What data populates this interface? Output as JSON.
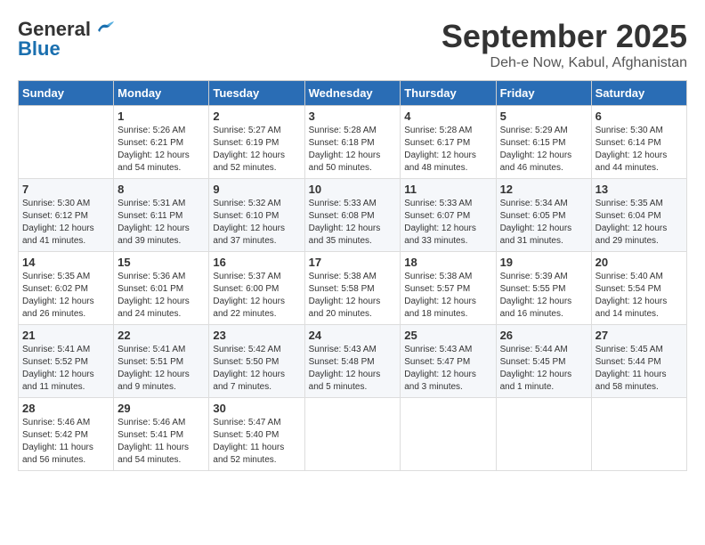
{
  "header": {
    "logo_line1": "General",
    "logo_line2": "Blue",
    "title": "September 2025",
    "subtitle": "Deh-e Now, Kabul, Afghanistan"
  },
  "weekdays": [
    "Sunday",
    "Monday",
    "Tuesday",
    "Wednesday",
    "Thursday",
    "Friday",
    "Saturday"
  ],
  "weeks": [
    [
      {
        "day": "",
        "info": ""
      },
      {
        "day": "1",
        "info": "Sunrise: 5:26 AM\nSunset: 6:21 PM\nDaylight: 12 hours\nand 54 minutes."
      },
      {
        "day": "2",
        "info": "Sunrise: 5:27 AM\nSunset: 6:19 PM\nDaylight: 12 hours\nand 52 minutes."
      },
      {
        "day": "3",
        "info": "Sunrise: 5:28 AM\nSunset: 6:18 PM\nDaylight: 12 hours\nand 50 minutes."
      },
      {
        "day": "4",
        "info": "Sunrise: 5:28 AM\nSunset: 6:17 PM\nDaylight: 12 hours\nand 48 minutes."
      },
      {
        "day": "5",
        "info": "Sunrise: 5:29 AM\nSunset: 6:15 PM\nDaylight: 12 hours\nand 46 minutes."
      },
      {
        "day": "6",
        "info": "Sunrise: 5:30 AM\nSunset: 6:14 PM\nDaylight: 12 hours\nand 44 minutes."
      }
    ],
    [
      {
        "day": "7",
        "info": "Sunrise: 5:30 AM\nSunset: 6:12 PM\nDaylight: 12 hours\nand 41 minutes."
      },
      {
        "day": "8",
        "info": "Sunrise: 5:31 AM\nSunset: 6:11 PM\nDaylight: 12 hours\nand 39 minutes."
      },
      {
        "day": "9",
        "info": "Sunrise: 5:32 AM\nSunset: 6:10 PM\nDaylight: 12 hours\nand 37 minutes."
      },
      {
        "day": "10",
        "info": "Sunrise: 5:33 AM\nSunset: 6:08 PM\nDaylight: 12 hours\nand 35 minutes."
      },
      {
        "day": "11",
        "info": "Sunrise: 5:33 AM\nSunset: 6:07 PM\nDaylight: 12 hours\nand 33 minutes."
      },
      {
        "day": "12",
        "info": "Sunrise: 5:34 AM\nSunset: 6:05 PM\nDaylight: 12 hours\nand 31 minutes."
      },
      {
        "day": "13",
        "info": "Sunrise: 5:35 AM\nSunset: 6:04 PM\nDaylight: 12 hours\nand 29 minutes."
      }
    ],
    [
      {
        "day": "14",
        "info": "Sunrise: 5:35 AM\nSunset: 6:02 PM\nDaylight: 12 hours\nand 26 minutes."
      },
      {
        "day": "15",
        "info": "Sunrise: 5:36 AM\nSunset: 6:01 PM\nDaylight: 12 hours\nand 24 minutes."
      },
      {
        "day": "16",
        "info": "Sunrise: 5:37 AM\nSunset: 6:00 PM\nDaylight: 12 hours\nand 22 minutes."
      },
      {
        "day": "17",
        "info": "Sunrise: 5:38 AM\nSunset: 5:58 PM\nDaylight: 12 hours\nand 20 minutes."
      },
      {
        "day": "18",
        "info": "Sunrise: 5:38 AM\nSunset: 5:57 PM\nDaylight: 12 hours\nand 18 minutes."
      },
      {
        "day": "19",
        "info": "Sunrise: 5:39 AM\nSunset: 5:55 PM\nDaylight: 12 hours\nand 16 minutes."
      },
      {
        "day": "20",
        "info": "Sunrise: 5:40 AM\nSunset: 5:54 PM\nDaylight: 12 hours\nand 14 minutes."
      }
    ],
    [
      {
        "day": "21",
        "info": "Sunrise: 5:41 AM\nSunset: 5:52 PM\nDaylight: 12 hours\nand 11 minutes."
      },
      {
        "day": "22",
        "info": "Sunrise: 5:41 AM\nSunset: 5:51 PM\nDaylight: 12 hours\nand 9 minutes."
      },
      {
        "day": "23",
        "info": "Sunrise: 5:42 AM\nSunset: 5:50 PM\nDaylight: 12 hours\nand 7 minutes."
      },
      {
        "day": "24",
        "info": "Sunrise: 5:43 AM\nSunset: 5:48 PM\nDaylight: 12 hours\nand 5 minutes."
      },
      {
        "day": "25",
        "info": "Sunrise: 5:43 AM\nSunset: 5:47 PM\nDaylight: 12 hours\nand 3 minutes."
      },
      {
        "day": "26",
        "info": "Sunrise: 5:44 AM\nSunset: 5:45 PM\nDaylight: 12 hours\nand 1 minute."
      },
      {
        "day": "27",
        "info": "Sunrise: 5:45 AM\nSunset: 5:44 PM\nDaylight: 11 hours\nand 58 minutes."
      }
    ],
    [
      {
        "day": "28",
        "info": "Sunrise: 5:46 AM\nSunset: 5:42 PM\nDaylight: 11 hours\nand 56 minutes."
      },
      {
        "day": "29",
        "info": "Sunrise: 5:46 AM\nSunset: 5:41 PM\nDaylight: 11 hours\nand 54 minutes."
      },
      {
        "day": "30",
        "info": "Sunrise: 5:47 AM\nSunset: 5:40 PM\nDaylight: 11 hours\nand 52 minutes."
      },
      {
        "day": "",
        "info": ""
      },
      {
        "day": "",
        "info": ""
      },
      {
        "day": "",
        "info": ""
      },
      {
        "day": "",
        "info": ""
      }
    ]
  ]
}
